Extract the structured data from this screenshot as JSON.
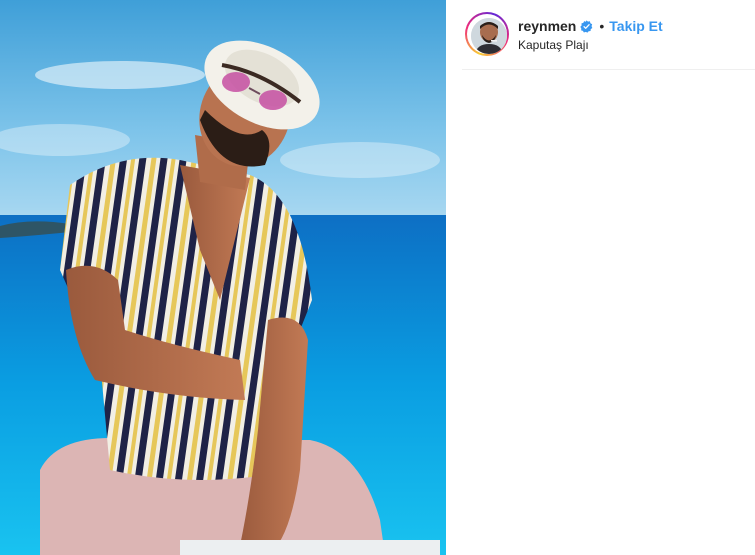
{
  "post": {
    "username": "reynmen",
    "separator": "•",
    "follow_label": "Takip Et",
    "location": "Kaputaş Plajı",
    "verified": true,
    "colors": {
      "follow": "#3897f0",
      "verified_badge": "#3897f0",
      "username": "#262626"
    }
  },
  "icons": {
    "verified": "verified-badge-icon"
  }
}
